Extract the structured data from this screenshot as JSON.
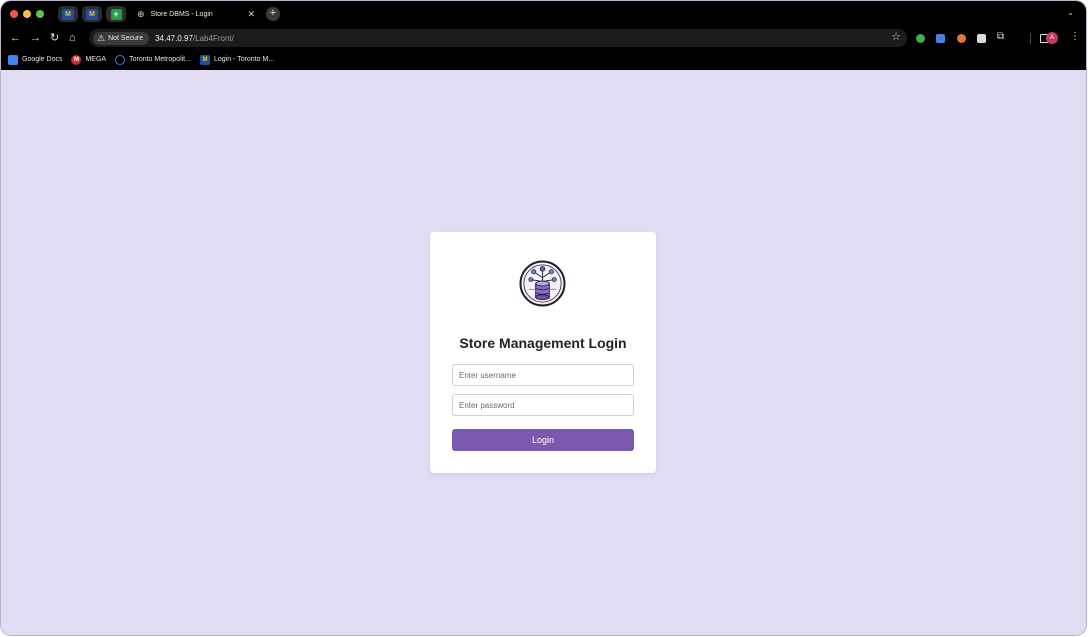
{
  "browser": {
    "tabs": {
      "active_title": "Store DBMS - Login",
      "pinned": [
        {
          "icon": "moodle-m-icon",
          "label": "M"
        },
        {
          "icon": "moodle-m-icon",
          "label": "M"
        },
        {
          "icon": "sheets-icon",
          "label": "+"
        }
      ]
    },
    "address": {
      "security_label": "Not Secure",
      "host": "34.47.0.97",
      "path": "/Lab4Front/"
    },
    "profile_initial": "A",
    "bookmarks": [
      {
        "label": "Google Docs",
        "icon": "google-docs-icon"
      },
      {
        "label": "MEGA",
        "icon": "mega-icon",
        "glyph": "M"
      },
      {
        "label": "Toronto Metropolit...",
        "icon": "tmu-icon"
      },
      {
        "label": "Login - Toronto M...",
        "icon": "moodle-m-icon",
        "glyph": "M"
      }
    ]
  },
  "login": {
    "title": "Store Management Login",
    "username_placeholder": "Enter username",
    "password_placeholder": "Enter password",
    "button_label": "Login"
  },
  "colors": {
    "page_background": "#e1dcf4",
    "button": "#7c59b0",
    "card": "#ffffff"
  }
}
